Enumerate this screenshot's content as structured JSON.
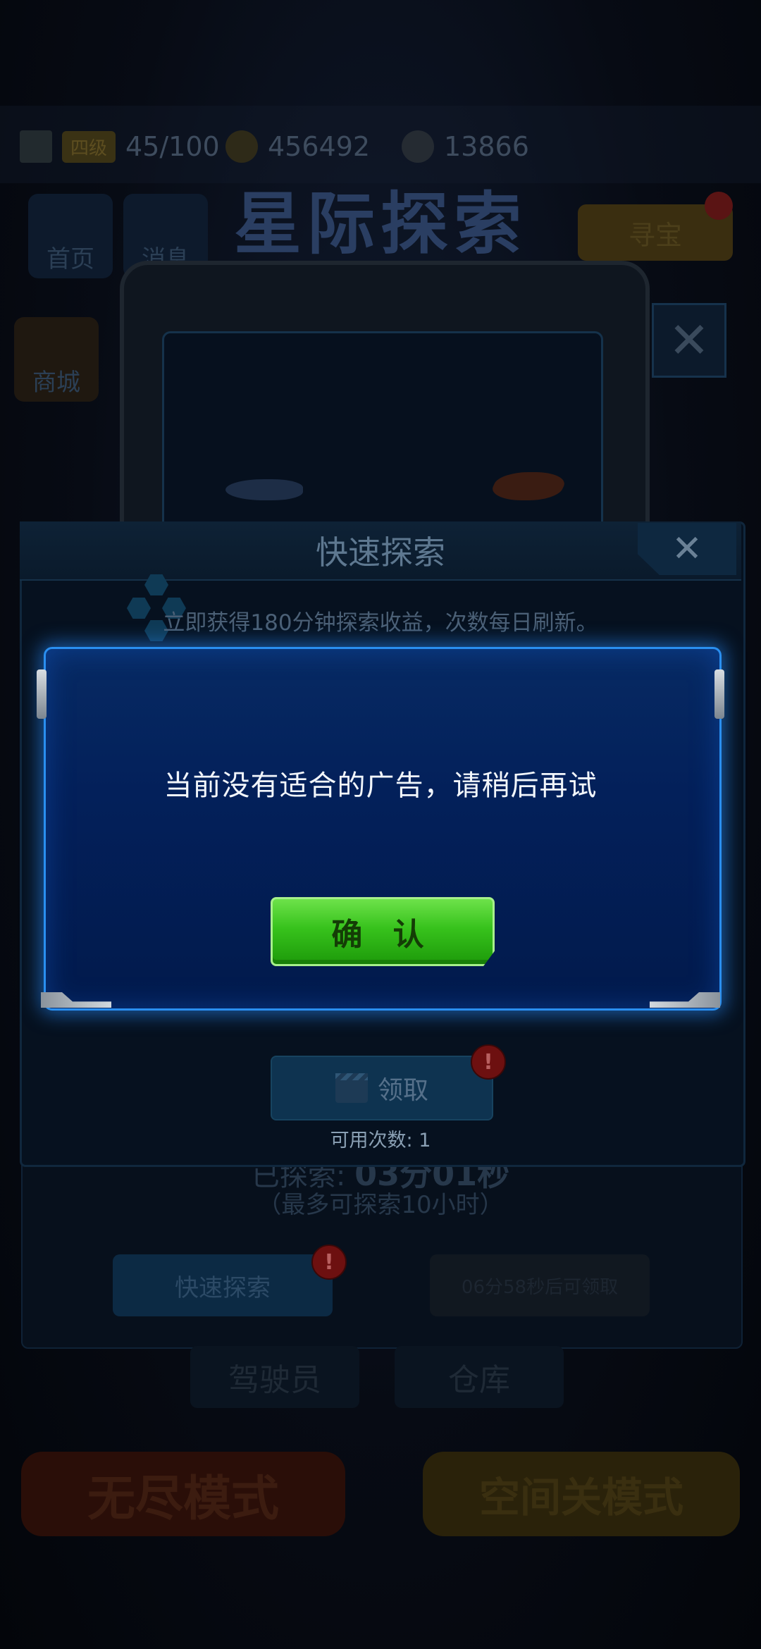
{
  "background": {
    "resources": [
      {
        "icon": "lightning-icon",
        "level_badge": "四级",
        "value": "45/100"
      },
      {
        "icon": "coin-icon",
        "value": "456492"
      },
      {
        "icon": "ore-icon",
        "value": "13866"
      }
    ],
    "game_title": "星际探索",
    "side_buttons": [
      {
        "label": "首页",
        "icon": "home-icon"
      },
      {
        "label": "消息",
        "icon": "mail-icon"
      },
      {
        "label": "商城",
        "icon": "shop-icon"
      }
    ],
    "gold_button": "寻宝",
    "explored_label": "已探索:",
    "explored_time": "03分01秒",
    "max_explore": "（最多可探索10小时）",
    "quick_explore_button": "快速探索",
    "claim_countdown_button": "06分58秒后可领取",
    "bottom_tabs": [
      "驾驶员",
      "仓库"
    ],
    "mode_buttons": [
      "无尽模式",
      "空间关模式"
    ]
  },
  "quick_explore_popup": {
    "title": "快速探索",
    "close_icon": "close-icon",
    "description": "立即获得180分钟探索收益，次数每日刷新。",
    "claim_button": "领取",
    "claim_icon": "video-clapper-icon",
    "warning_badge": "!",
    "uses_label": "可用次数: 1"
  },
  "ad_dialog": {
    "message": "当前没有适合的广告，请稍后再试",
    "confirm_button": "确 认"
  },
  "colors": {
    "dialog_bg": "#03205a",
    "dialog_border": "#2a8ff0",
    "confirm_green": "#37c21c",
    "warning_red": "#6d1010"
  }
}
